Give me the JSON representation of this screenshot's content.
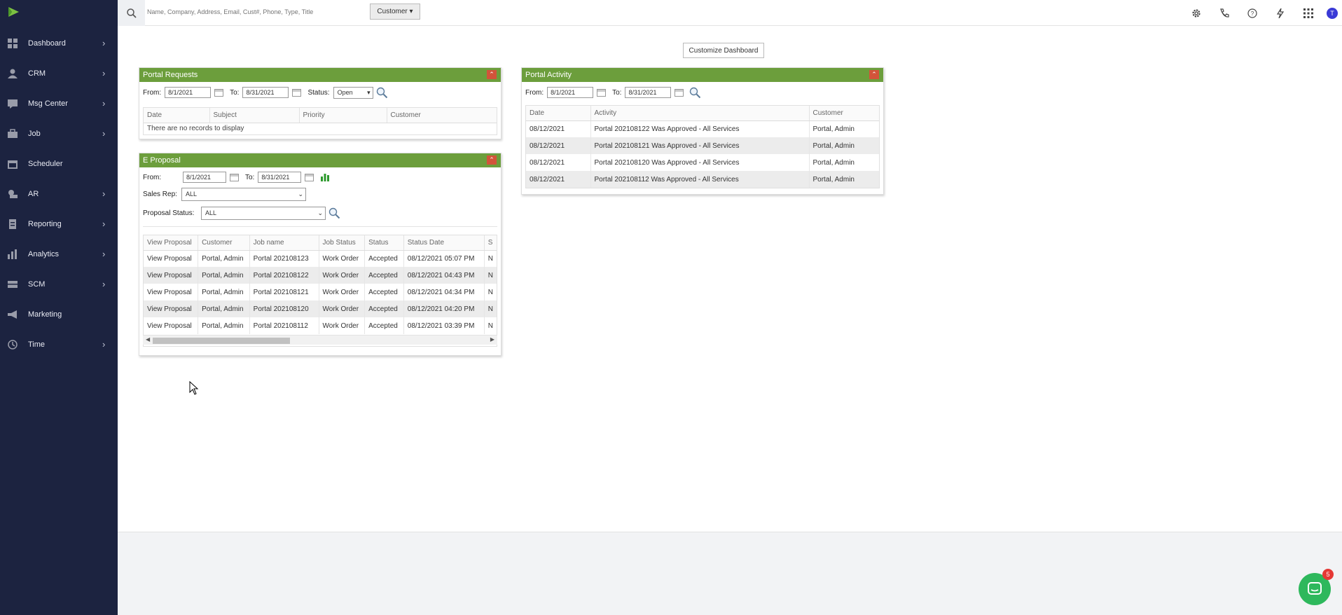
{
  "sidebar": {
    "items": [
      {
        "label": "Dashboard",
        "icon": "dashboard-icon"
      },
      {
        "label": "CRM",
        "icon": "user-icon"
      },
      {
        "label": "Msg Center",
        "icon": "message-icon"
      },
      {
        "label": "Job",
        "icon": "briefcase-icon"
      },
      {
        "label": "Scheduler",
        "icon": "calendar-icon"
      },
      {
        "label": "AR",
        "icon": "money-icon"
      },
      {
        "label": "Reporting",
        "icon": "report-icon"
      },
      {
        "label": "Analytics",
        "icon": "bar-chart-icon"
      },
      {
        "label": "SCM",
        "icon": "truck-icon"
      },
      {
        "label": "Marketing",
        "icon": "megaphone-icon"
      },
      {
        "label": "Time",
        "icon": "clock-icon"
      }
    ]
  },
  "topbar": {
    "search_placeholder": "Name, Company, Address, Email, Cust#, Phone, Type, Title",
    "customer_dropdown": "Customer ▾",
    "avatar_initial": "T"
  },
  "main": {
    "customize_label": "Customize Dashboard"
  },
  "portal_requests": {
    "title": "Portal Requests",
    "from_label": "From:",
    "from_value": "8/1/2021",
    "to_label": "To:",
    "to_value": "8/31/2021",
    "status_label": "Status:",
    "status_value": "Open",
    "columns": [
      "Date",
      "Subject",
      "Priority",
      "Customer"
    ],
    "empty_message": "There are no records to display"
  },
  "e_proposal": {
    "title": "E Proposal",
    "from_label": "From:",
    "from_value": "8/1/2021",
    "to_label": "To:",
    "to_value": "8/31/2021",
    "sales_rep_label": "Sales Rep:",
    "sales_rep_value": "ALL",
    "proposal_status_label": "Proposal Status:",
    "proposal_status_value": "ALL",
    "columns": [
      "View Proposal",
      "Customer",
      "Job name",
      "Job Status",
      "Status",
      "Status Date",
      "S"
    ],
    "rows": [
      [
        "View Proposal",
        "Portal, Admin",
        "Portal 202108123",
        "Work Order",
        "Accepted",
        "08/12/2021 05:07 PM",
        "N"
      ],
      [
        "View Proposal",
        "Portal, Admin",
        "Portal 202108122",
        "Work Order",
        "Accepted",
        "08/12/2021 04:43 PM",
        "N"
      ],
      [
        "View Proposal",
        "Portal, Admin",
        "Portal 202108121",
        "Work Order",
        "Accepted",
        "08/12/2021 04:34 PM",
        "N"
      ],
      [
        "View Proposal",
        "Portal, Admin",
        "Portal 202108120",
        "Work Order",
        "Accepted",
        "08/12/2021 04:20 PM",
        "N"
      ],
      [
        "View Proposal",
        "Portal, Admin",
        "Portal 202108112",
        "Work Order",
        "Accepted",
        "08/12/2021 03:39 PM",
        "N"
      ]
    ]
  },
  "portal_activity": {
    "title": "Portal Activity",
    "from_label": "From:",
    "from_value": "8/1/2021",
    "to_label": "To:",
    "to_value": "8/31/2021",
    "columns": [
      "Date",
      "Activity",
      "Customer"
    ],
    "rows": [
      [
        "08/12/2021",
        "Portal 202108122 Was Approved - All Services",
        "Portal, Admin"
      ],
      [
        "08/12/2021",
        "Portal 202108121 Was Approved - All Services",
        "Portal, Admin"
      ],
      [
        "08/12/2021",
        "Portal 202108120 Was Approved - All Services",
        "Portal, Admin"
      ],
      [
        "08/12/2021",
        "Portal 202108112 Was Approved - All Services",
        "Portal, Admin"
      ]
    ]
  },
  "chat": {
    "badge_count": "5"
  },
  "colors": {
    "sidebar": "#1c2340",
    "panel_header": "#6c9e3c",
    "collapse_button": "#d2543a",
    "chat": "#2eb85c"
  }
}
